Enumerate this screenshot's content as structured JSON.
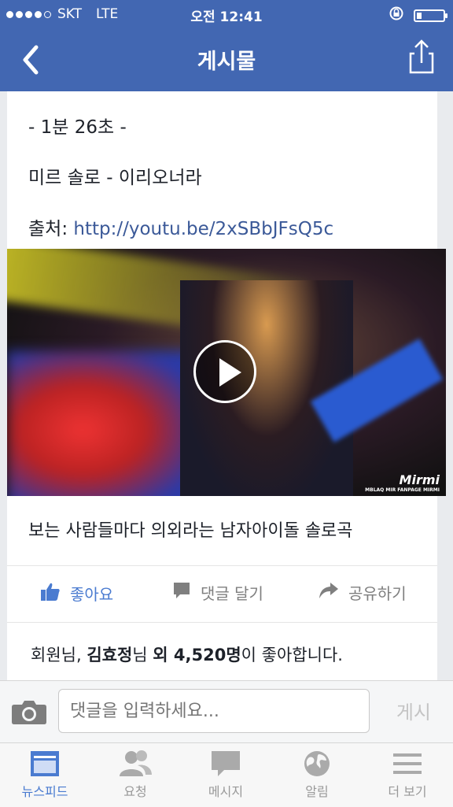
{
  "status_bar": {
    "carrier": "SKT",
    "network": "LTE",
    "time": "오전 12:41",
    "battery_level": 0.2
  },
  "nav": {
    "title": "게시물",
    "back_icon": "chevron-left-icon",
    "share_icon": "share-icon"
  },
  "post": {
    "line1": "- 1분 26초 -",
    "line2": "미르 솔로 - 이리오너라",
    "source_label": "출처: ",
    "source_link": "http://youtu.be/2xSBbJFsQ5c",
    "video": {
      "watermark": "Mirmi",
      "watermark_sub": "MBLAQ MIR FANPAGE MIRMI"
    },
    "caption": "보는 사람들마다 의외라는 남자아이돌 솔로곡"
  },
  "actions": {
    "like": "좋아요",
    "comment": "댓글 달기",
    "share": "공유하기"
  },
  "likes": {
    "prefix": "회원님, ",
    "friend": "김효정",
    "mid": "님 ",
    "count_text": "외 4,520명",
    "suffix": "이 좋아합니다."
  },
  "comment_bar": {
    "placeholder": "댓글을 입력하세요...",
    "post_label": "게시"
  },
  "tab_bar": [
    {
      "label": "뉴스피드",
      "icon": "newsfeed-icon",
      "active": true
    },
    {
      "label": "요청",
      "icon": "friend-requests-icon",
      "active": false
    },
    {
      "label": "메시지",
      "icon": "messages-icon",
      "active": false
    },
    {
      "label": "알림",
      "icon": "globe-icon",
      "active": false
    },
    {
      "label": "더 보기",
      "icon": "menu-icon",
      "active": false
    }
  ],
  "colors": {
    "brand": "#4267b2",
    "link": "#3b5998",
    "accent": "#4a7bd0"
  }
}
